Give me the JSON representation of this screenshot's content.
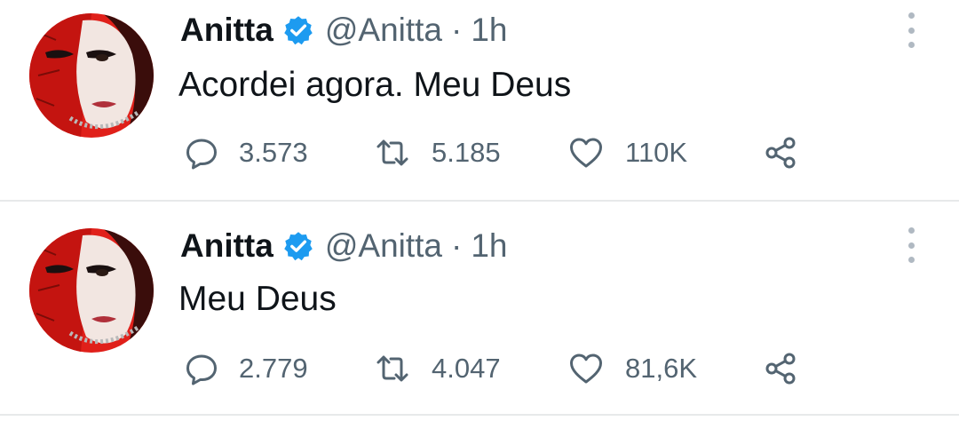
{
  "tweets": [
    {
      "display_name": "Anitta",
      "verified_icon": "verified-badge-icon",
      "handle": "@Anitta",
      "separator": "·",
      "time": "1h",
      "text": "Acordei agora. Meu Deus",
      "replies": "3.573",
      "retweets": "5.185",
      "likes": "110K"
    },
    {
      "display_name": "Anitta",
      "verified_icon": "verified-badge-icon",
      "handle": "@Anitta",
      "separator": "·",
      "time": "1h",
      "text": "Meu Deus",
      "replies": "2.779",
      "retweets": "4.047",
      "likes": "81,6K"
    }
  ],
  "icons": {
    "reply": "reply-bubble-icon",
    "retweet": "retweet-icon",
    "like": "heart-icon",
    "share": "share-icon",
    "more": "more-options-icon"
  },
  "colors": {
    "verified": "#1d9bf0",
    "secondary_text": "#536471",
    "primary_text": "#0f1419",
    "divider": "#e7e9ea",
    "avatar_red": "#e0201a"
  }
}
